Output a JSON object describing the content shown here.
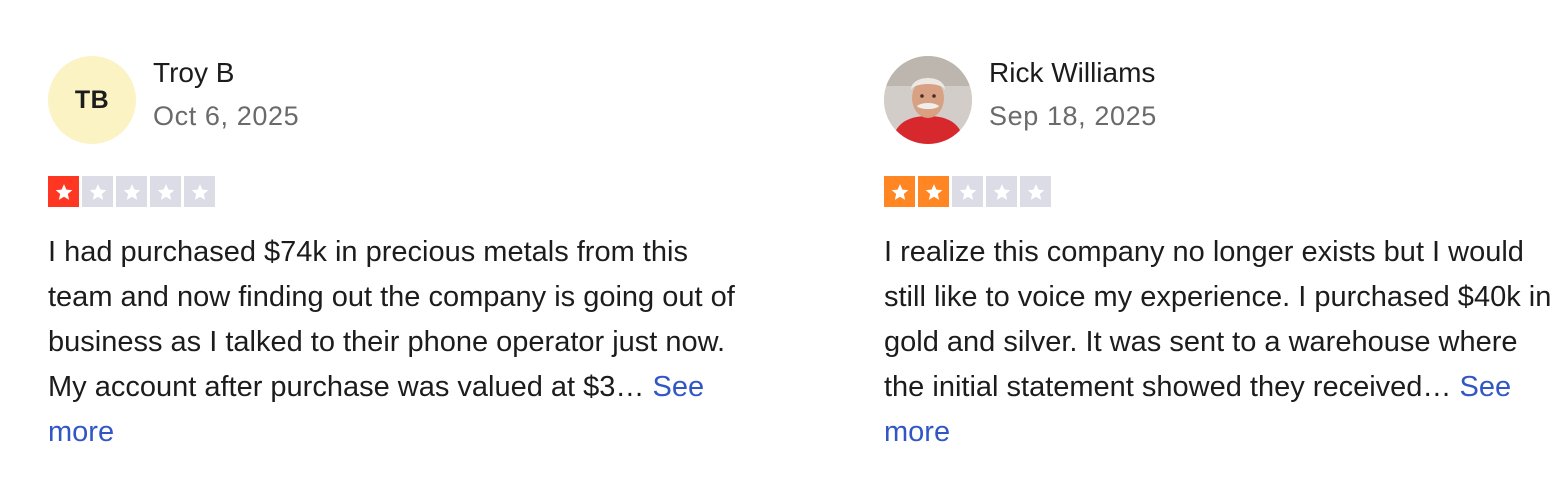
{
  "reviews": [
    {
      "author": "Troy B",
      "initials": "TB",
      "date": "Oct 6, 2025",
      "rating": 1,
      "rating_color": "#ff3722",
      "text": "I had purchased $74k in precious metals from this team and now finding out the company is going out of business as I talked to their phone operator just now. My account after purchase was valued at $3…",
      "see_more": "See more"
    },
    {
      "author": "Rick Williams",
      "avatar": "profile-photo",
      "date": "Sep 18, 2025",
      "rating": 2,
      "rating_color": "#ff8622",
      "text": "I realize this company no longer exists but I would still like to voice my experience. I purchased $40k in gold and silver. It was sent to a warehouse where the initial statement showed they received…",
      "see_more": "See more"
    }
  ],
  "colors": {
    "empty_star": "#dcdce6",
    "link": "#3257c5",
    "initials_bg": "#fbf3c4"
  }
}
